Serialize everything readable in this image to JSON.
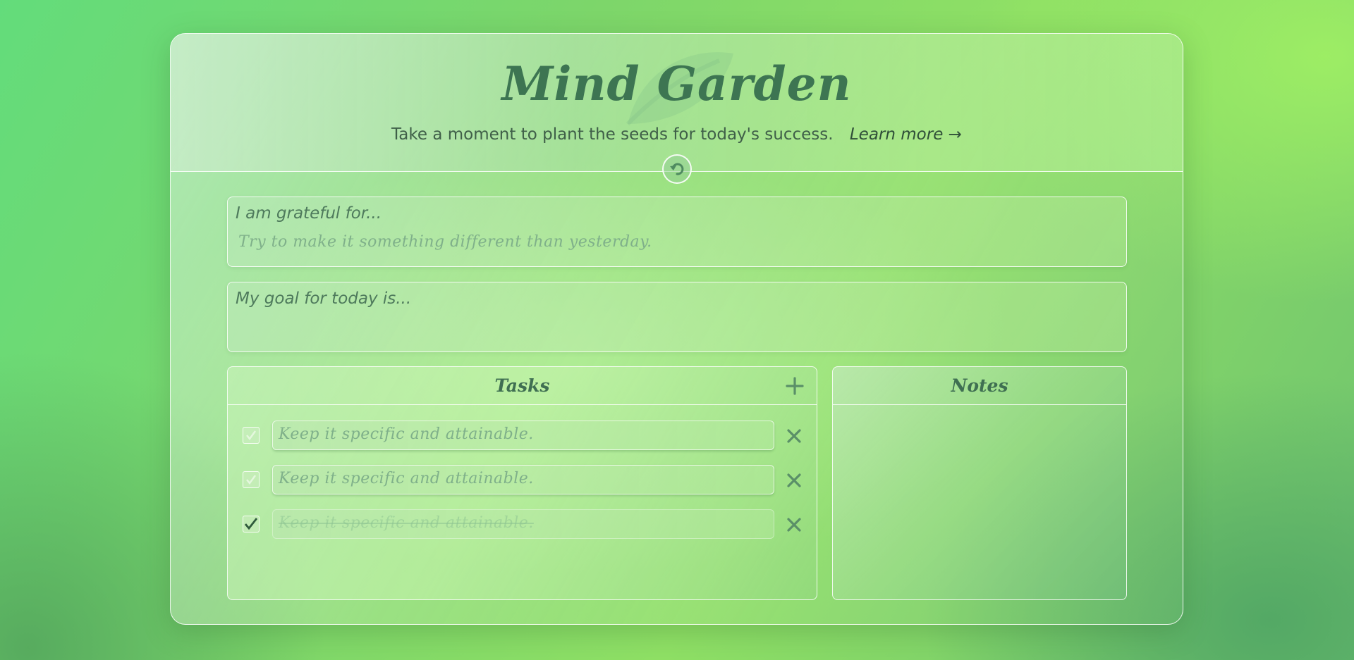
{
  "header": {
    "title": "Mind Garden",
    "subtitle": "Take a moment to plant the seeds for today's success.",
    "learn_more": "Learn more →"
  },
  "icons": {
    "leaf": "leaf-icon",
    "reset": "undo-icon",
    "add": "plus-icon",
    "delete": "x-icon",
    "check": "checkmark-icon"
  },
  "gratitude": {
    "label": "I am grateful for...",
    "placeholder": "Try to make it something different than yesterday."
  },
  "goal": {
    "label": "My goal for today is..."
  },
  "tasks": {
    "title": "Tasks",
    "items": [
      {
        "placeholder": "Keep it specific and attainable.",
        "checked": false
      },
      {
        "placeholder": "Keep it specific and attainable.",
        "checked": false
      },
      {
        "placeholder": "Keep it specific and attainable.",
        "checked": true
      }
    ]
  },
  "notes": {
    "title": "Notes"
  },
  "colors": {
    "title_green": "#3d7552",
    "text_dark": "#3f5f48",
    "placeholder_green": "#7fb08a",
    "border_white": "#ffffff"
  }
}
